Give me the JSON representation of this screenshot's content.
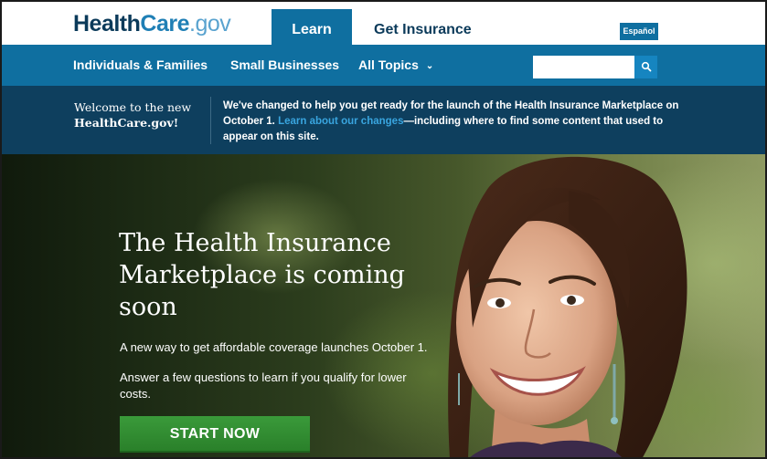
{
  "header": {
    "logo_part1": "Health",
    "logo_part2": "Care",
    "logo_part3": ".gov",
    "tabs": [
      {
        "label": "Learn",
        "active": true
      },
      {
        "label": "Get Insurance",
        "active": false
      }
    ],
    "language_button": "Español"
  },
  "nav": {
    "items": [
      {
        "label": "Individuals & Families"
      },
      {
        "label": "Small Businesses"
      },
      {
        "label": "All Topics"
      }
    ],
    "search": {
      "placeholder": "",
      "value": ""
    },
    "search_icon": "search-icon"
  },
  "notice": {
    "welcome_line1": "Welcome to the new",
    "welcome_line2": "HealthCare.gov!",
    "text_before": "We've changed to help you get ready for the launch of the Health Insurance Marketplace on October 1. ",
    "link_text": "Learn about our changes",
    "text_after": "—including where to find some content that used to appear on this site."
  },
  "hero": {
    "title": "The Health Insurance Marketplace is coming soon",
    "subtitle1": "A new way to get affordable coverage launches October 1.",
    "subtitle2": "Answer a few questions to learn if you qualify for lower costs.",
    "cta": "START NOW"
  },
  "colors": {
    "brand_dark": "#0b3a5a",
    "nav_blue": "#0f6fa0",
    "notice_bg": "#0e3f5e",
    "link_blue": "#39a5df",
    "cta_green": "#2f8f2f"
  }
}
